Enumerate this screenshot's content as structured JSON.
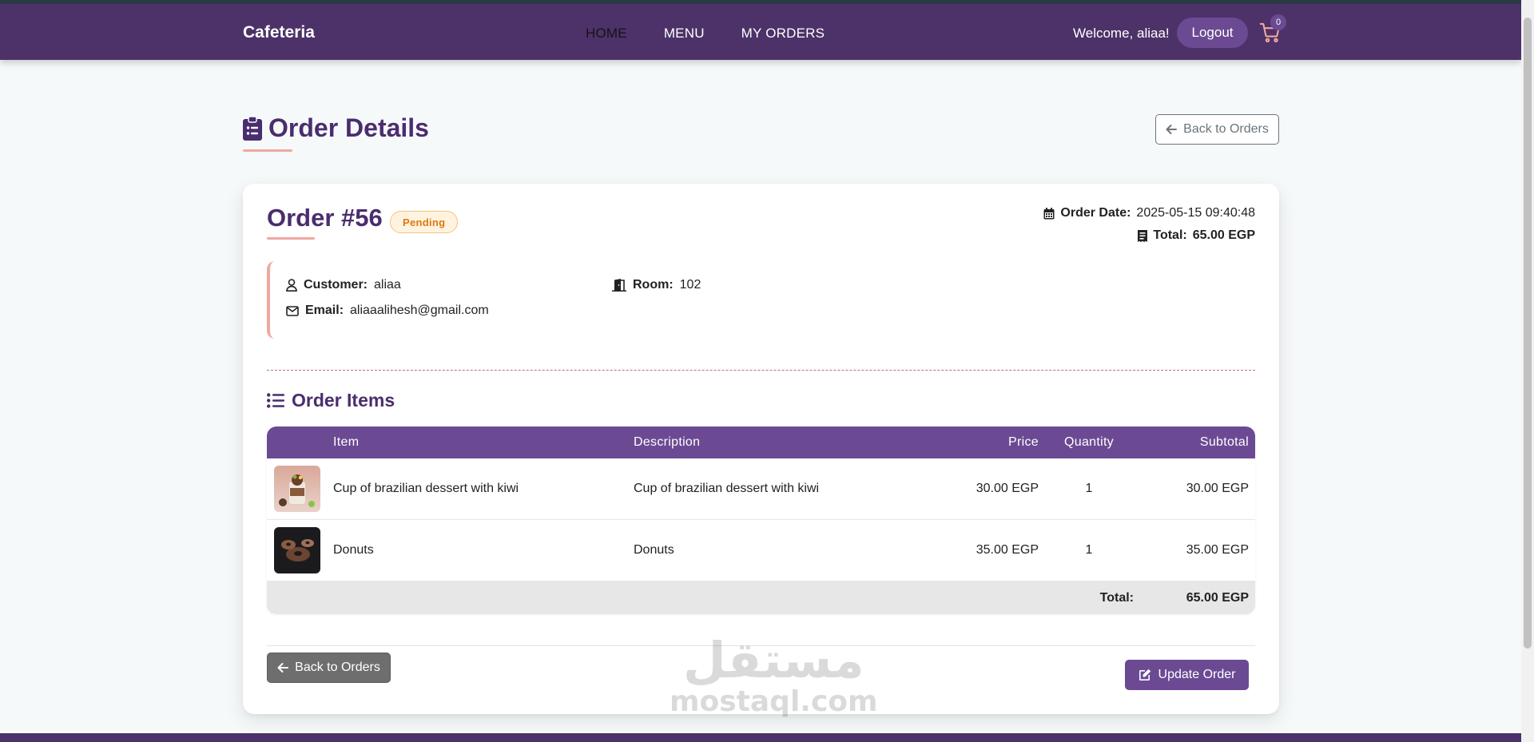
{
  "brand": "Cafeteria",
  "nav": {
    "items": [
      "HOME",
      "MENU",
      "MY ORDERS"
    ],
    "active": "HOME"
  },
  "user": {
    "welcome": "Welcome, aliaa!",
    "logout_label": "Logout",
    "cart_count": "0"
  },
  "page": {
    "title": "Order Details",
    "back_label": "Back to Orders"
  },
  "order": {
    "number": "Order #56",
    "status": "Pending",
    "date_label": "Order Date:",
    "date_value": "2025-05-15 09:40:48",
    "total_label": "Total:",
    "total_value": "65.00 EGP",
    "customer_label": "Customer:",
    "customer_value": "aliaa",
    "room_label": "Room:",
    "room_value": "102",
    "email_label": "Email:",
    "email_value": "aliaaalihesh@gmail.com"
  },
  "items_section": {
    "title": "Order Items",
    "columns": [
      "Item",
      "Description",
      "Price",
      "Quantity",
      "Subtotal"
    ],
    "rows": [
      {
        "item": "Cup of brazilian dessert with kiwi",
        "description": "Cup of brazilian dessert with kiwi",
        "price": "30.00 EGP",
        "quantity": "1",
        "subtotal": "30.00 EGP"
      },
      {
        "item": "Donuts",
        "description": "Donuts",
        "price": "35.00 EGP",
        "quantity": "1",
        "subtotal": "35.00 EGP"
      }
    ],
    "total_label": "Total:",
    "total_value": "65.00 EGP"
  },
  "actions": {
    "back_label": "Back to Orders",
    "update_label": "Update Order"
  },
  "watermark": {
    "arabic": "مستقل",
    "latin": "mostaql.com"
  },
  "colors": {
    "primary": "#4c3268",
    "accent": "#6b4a93",
    "underline": "#f0a8a0",
    "pending": "#db7a11"
  }
}
